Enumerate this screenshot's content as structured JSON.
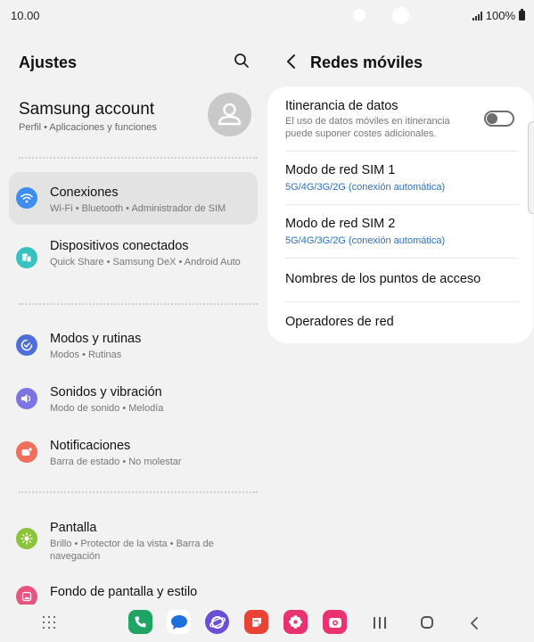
{
  "status": {
    "time": "10.00",
    "battery": "100%"
  },
  "left": {
    "title": "Ajustes",
    "account": {
      "name": "Samsung account",
      "subtitle": "Perfil  •  Aplicaciones y funciones"
    },
    "items": [
      {
        "title": "Conexiones",
        "subtitle": "Wi-Fi  •  Bluetooth  •  Administrador de SIM",
        "icon": "wifi-icon",
        "color": "#3d8ef0"
      },
      {
        "title": "Dispositivos conectados",
        "subtitle": "Quick Share  •  Samsung DeX  •  Android Auto",
        "icon": "connected-devices-icon",
        "color": "#37c2c0"
      },
      {
        "title": "Modos y rutinas",
        "subtitle": "Modos  •  Rutinas",
        "icon": "modes-routines-icon",
        "color": "#4e6fd9"
      },
      {
        "title": "Sonidos y vibración",
        "subtitle": "Modo de sonido  •  Melodía",
        "icon": "sound-icon",
        "color": "#7c74e3"
      },
      {
        "title": "Notificaciones",
        "subtitle": "Barra de estado  •  No molestar",
        "icon": "notifications-icon",
        "color": "#ef6f5b"
      },
      {
        "title": "Pantalla",
        "subtitle": "Brillo  •  Protector de la vista  •  Barra de navegación",
        "icon": "display-icon",
        "color": "#8bc33a"
      },
      {
        "title": "Fondo de pantalla y estilo",
        "subtitle": "",
        "icon": "wallpaper-icon",
        "color": "#e9537f"
      }
    ]
  },
  "right": {
    "title": "Redes móviles",
    "rows": [
      {
        "title": "Itinerancia de datos",
        "subtitle": "El uso de datos móviles en itinerancia puede suponer costes adicionales.",
        "toggle": false
      },
      {
        "title": "Modo de red SIM 1",
        "subtitle": "5G/4G/3G/2G (conexión automática)"
      },
      {
        "title": "Modo de red SIM 2",
        "subtitle": "5G/4G/3G/2G (conexión automática)"
      },
      {
        "title": "Nombres de los puntos de acceso"
      },
      {
        "title": "Operadores de red"
      }
    ]
  },
  "dock": [
    {
      "icon": "phone-app-icon",
      "color": "#1fa463"
    },
    {
      "icon": "messages-app-icon",
      "color": "#1d6fe0"
    },
    {
      "icon": "internet-app-icon",
      "color": "#6a4fd6"
    },
    {
      "icon": "notes-app-icon",
      "color": "#ea4335"
    },
    {
      "icon": "gallery-app-icon",
      "color": "#e8336f"
    },
    {
      "icon": "camera-app-icon",
      "color": "#e8336f"
    }
  ]
}
